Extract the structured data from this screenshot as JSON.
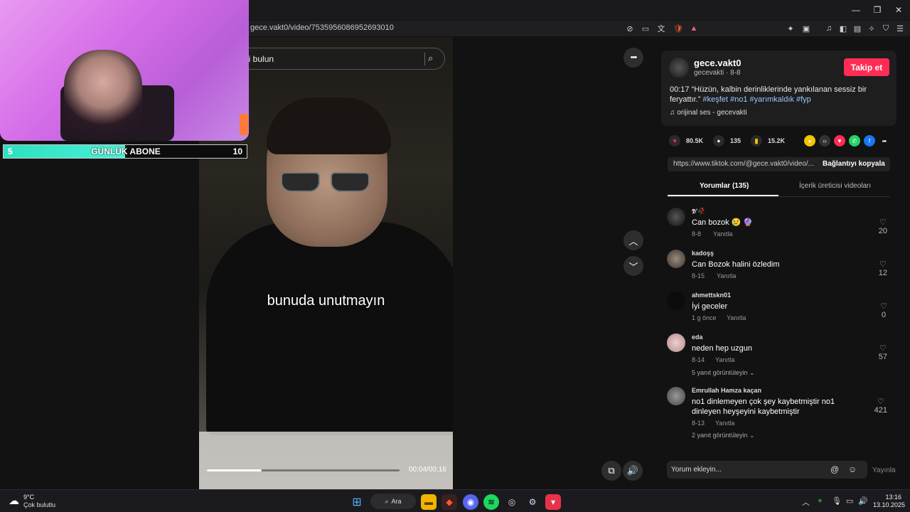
{
  "browser": {
    "url": "gece.vakt0/video/7535956086952693010",
    "window_controls": [
      "—",
      "❐",
      "✕"
    ]
  },
  "video": {
    "search_placeholder": "ği bulun",
    "caption": "bunuda unutmayın",
    "time": "00:04/00:16",
    "progress": 0.285,
    "more_label": "•••"
  },
  "post": {
    "username": "gece.vakt0",
    "subline": "gecevakti · 8-8",
    "follow_label": "Takip et",
    "desc_prefix": "00:17 “Hüzün, kalbin derinliklerinde yankılanan sessiz bir feryattır.”",
    "hashtags": [
      "#keşfet",
      "#no1",
      "#yarımkaldık",
      "#fyp"
    ],
    "sound": "orijinal ses - gecevakti",
    "likes": "80.5K",
    "comments": "135",
    "saves": "15.2K",
    "link": "https://www.tiktok.com/@gece.vakt0/video/...",
    "copy_label": "Bağlantıyı kopyala",
    "tab_comments": "Yorumlar (135)",
    "tab_creator": "İçerik üreticisi videoları",
    "comment_placeholder": "Yorum ekleyin...",
    "post_label": "Yayınla"
  },
  "comments": [
    {
      "user": "𝕯'🥀",
      "text": "Can bozok 😢 🔮",
      "date": "8-8",
      "reply": "Yanıtla",
      "likes": "20",
      "replies": ""
    },
    {
      "user": "kadoşş",
      "text": "Can Bozok halini özledim",
      "date": "8-15",
      "reply": "Yanıtla",
      "likes": "12",
      "replies": ""
    },
    {
      "user": "ahmettskn01",
      "text": "İyi geceler",
      "date": "1 g önce",
      "reply": "Yanıtla",
      "likes": "0",
      "replies": ""
    },
    {
      "user": "eda",
      "text": "neden hep uzgun",
      "date": "8-14",
      "reply": "Yanıtla",
      "likes": "57",
      "replies": "5 yanıt görüntüleyin ⌄"
    },
    {
      "user": "Emrullah Hamza kaçan",
      "text": "no1 dinlemeyen çok şey kaybetmiştir no1 dinleyen heyşeyini kaybetmiştir",
      "date": "8-13",
      "reply": "Yanıtla",
      "likes": "421",
      "replies": "2 yanıt görüntüleyin ⌄"
    }
  ],
  "overlay": {
    "sub_label": "GÜNLÜK ABONE",
    "sub_current": "5",
    "sub_goal": "10",
    "sub_progress": 0.5
  },
  "taskbar": {
    "weather_temp": "9°C",
    "weather_desc": "Çok bulutlu",
    "search_label": "Ara",
    "time": "13:16",
    "date": "13.10.2025"
  },
  "colors": {
    "follow": "#fe2c55",
    "hashtag": "#9ac6ff",
    "sub_fill": "#2ee0c0"
  }
}
